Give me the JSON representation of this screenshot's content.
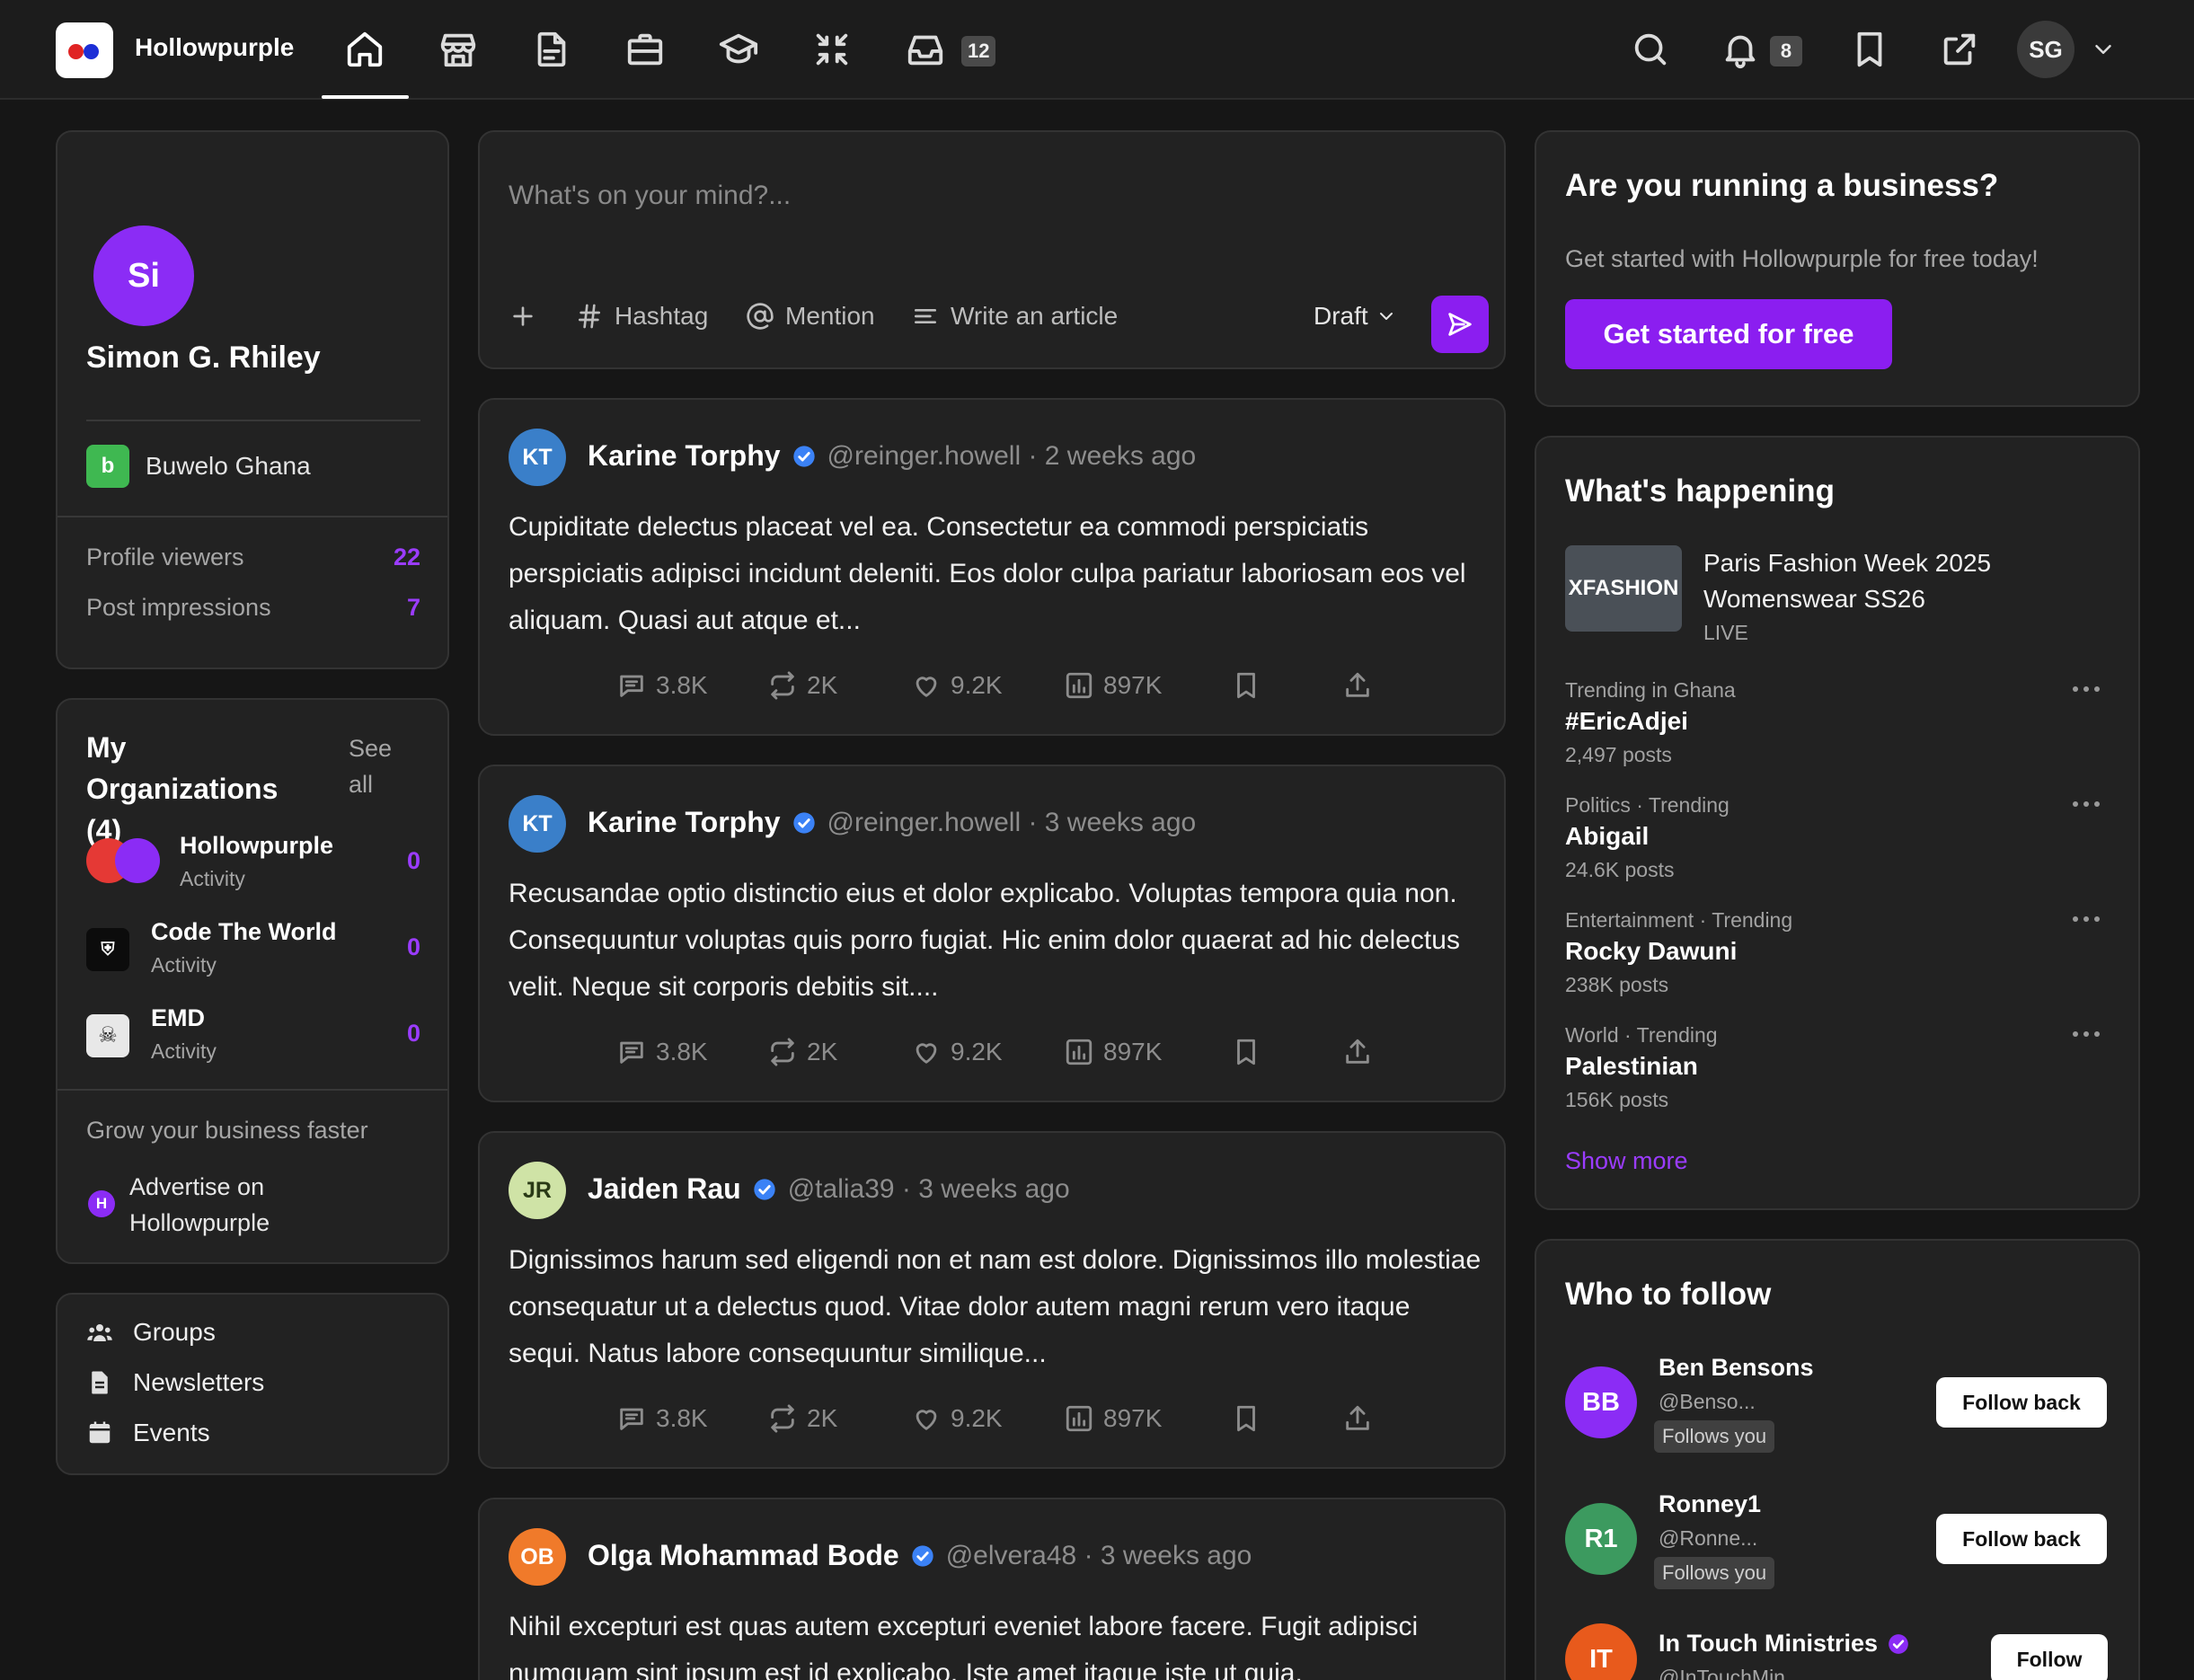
{
  "app": {
    "brand": "Hollowpurple"
  },
  "nav": {
    "messages_badge": "12",
    "notifications_badge": "8",
    "user_initials": "SG"
  },
  "profile": {
    "initials": "Si",
    "name": "Simon G. Rhiley",
    "company_badge": "b",
    "company": "Buwelo Ghana",
    "stats": [
      {
        "label": "Profile viewers",
        "value": "22"
      },
      {
        "label": "Post impressions",
        "value": "7"
      }
    ]
  },
  "organizations": {
    "title": "My Organizations (4)",
    "see_all": "See all",
    "items": [
      {
        "name": "Hollowpurple",
        "sub": "Activity",
        "count": "0"
      },
      {
        "name": "Code The World",
        "sub": "Activity",
        "count": "0"
      },
      {
        "name": "EMD",
        "sub": "Activity",
        "count": "0"
      }
    ],
    "grow_text": "Grow your business faster",
    "advertise_badge": "H",
    "advertise": "Advertise on Hollowpurple"
  },
  "quick_links": [
    "Groups",
    "Newsletters",
    "Events"
  ],
  "composer": {
    "placeholder": "What's on your mind?...",
    "hashtag": "Hashtag",
    "mention": "Mention",
    "article": "Write an article",
    "visibility": "Draft"
  },
  "posts": [
    {
      "initials": "KT",
      "author": "Karine Torphy",
      "handle": "@reinger.howell · 2 weeks ago",
      "body": "Cupiditate delectus placeat vel ea. Consectetur ea commodi perspiciatis perspiciatis adipisci incidunt deleniti. Eos dolor culpa pariatur laboriosam eos vel aliquam. Quasi aut atque et...",
      "comments": "3.8K",
      "reposts": "2K",
      "likes": "9.2K",
      "views": "897K"
    },
    {
      "initials": "KT",
      "author": "Karine Torphy",
      "handle": "@reinger.howell · 3 weeks ago",
      "body": "Recusandae optio distinctio eius et dolor explicabo. Voluptas tempora quia non. Consequuntur voluptas quis porro fugiat. Hic enim dolor quaerat ad hic delectus velit. Neque sit corporis debitis sit....",
      "comments": "3.8K",
      "reposts": "2K",
      "likes": "9.2K",
      "views": "897K"
    },
    {
      "initials": "JR",
      "author": "Jaiden Rau",
      "handle": "@talia39 · 3 weeks ago",
      "body": "Dignissimos harum sed eligendi non et nam est dolore. Dignissimos illo molestiae consequatur ut a delectus quod. Vitae dolor autem magni rerum vero itaque sequi. Natus labore consequuntur similique...",
      "comments": "3.8K",
      "reposts": "2K",
      "likes": "9.2K",
      "views": "897K"
    },
    {
      "initials": "OB",
      "author": "Olga Mohammad Bode",
      "handle": "@elvera48 · 3 weeks ago",
      "body": "Nihil excepturi est quas autem excepturi eveniet labore facere. Fugit adipisci numquam sint ipsum est id explicabo. Iste amet itaque iste ut quia."
    }
  ],
  "business": {
    "title": "Are you running a business?",
    "subtitle": "Get started with Hollowpurple for free today!",
    "cta": "Get started for free"
  },
  "happening": {
    "title": "What's happening",
    "featured": {
      "thumb": "XFASHION",
      "title": "Paris Fashion Week 2025 Womenswear SS26",
      "status": "LIVE"
    },
    "trends": [
      {
        "meta": "Trending in Ghana",
        "topic": "#EricAdjei",
        "count": "2,497 posts"
      },
      {
        "meta": "Politics · Trending",
        "topic": "Abigail",
        "count": "24.6K posts"
      },
      {
        "meta": "Entertainment · Trending",
        "topic": "Rocky Dawuni",
        "count": "238K posts"
      },
      {
        "meta": "World · Trending",
        "topic": "Palestinian",
        "count": "156K posts"
      }
    ],
    "show_more": "Show more"
  },
  "who_to_follow": {
    "title": "Who to follow",
    "people": [
      {
        "initials": "BB",
        "name": "Ben Bensons",
        "handle": "@Benso...",
        "tag": "Follows you",
        "action": "Follow back"
      },
      {
        "initials": "R1",
        "name": "Ronney1",
        "handle": "@Ronne...",
        "tag": "Follows you",
        "action": "Follow back"
      },
      {
        "initials": "IT",
        "name": "In Touch Ministries",
        "handle": "@InTouchMin...",
        "action": "Follow"
      }
    ]
  },
  "colors": {
    "accent": "#8b1ef0",
    "background": "#161616",
    "card": "#222222",
    "verified": "#3b82f6"
  }
}
